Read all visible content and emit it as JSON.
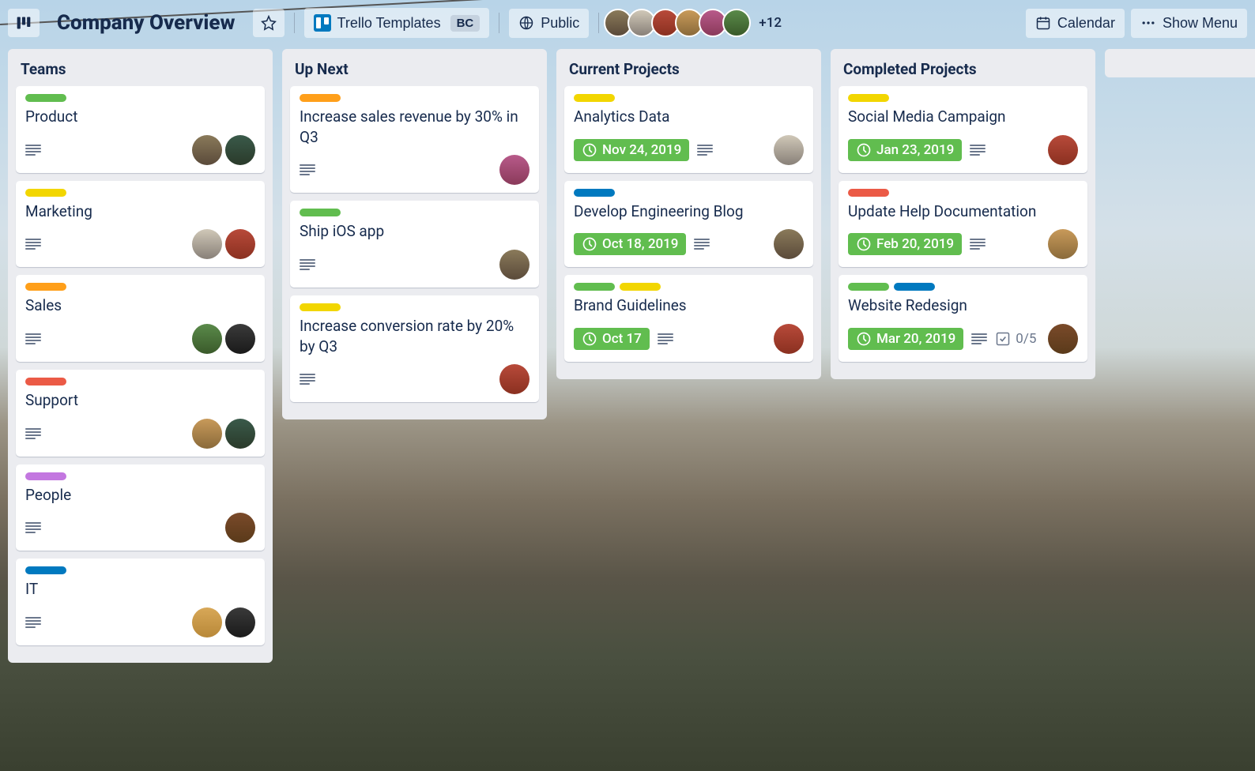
{
  "header": {
    "board_title": "Company Overview",
    "team_name": "Trello Templates",
    "team_badge": "BC",
    "visibility": "Public",
    "more_members": "+12",
    "calendar_label": "Calendar",
    "show_menu_label": "Show Menu"
  },
  "lists": [
    {
      "title": "Teams",
      "cards": [
        {
          "labels": [
            "green"
          ],
          "title": "Product",
          "has_desc": true,
          "avatars": [
            "av1",
            "av2"
          ]
        },
        {
          "labels": [
            "yellow"
          ],
          "title": "Marketing",
          "has_desc": true,
          "avatars": [
            "av3",
            "av4"
          ]
        },
        {
          "labels": [
            "orange"
          ],
          "title": "Sales",
          "has_desc": true,
          "avatars": [
            "av5",
            "av6"
          ]
        },
        {
          "labels": [
            "red"
          ],
          "title": "Support",
          "has_desc": true,
          "avatars": [
            "av7",
            "av2"
          ]
        },
        {
          "labels": [
            "purple"
          ],
          "title": "People",
          "has_desc": true,
          "avatars": [
            "av11"
          ]
        },
        {
          "labels": [
            "blue"
          ],
          "title": "IT",
          "has_desc": true,
          "avatars": [
            "av10",
            "av6"
          ]
        }
      ]
    },
    {
      "title": "Up Next",
      "cards": [
        {
          "labels": [
            "orange"
          ],
          "title": "Increase sales revenue by 30% in Q3",
          "has_desc": true,
          "avatars": [
            "av8"
          ]
        },
        {
          "labels": [
            "green"
          ],
          "title": "Ship iOS app",
          "has_desc": true,
          "avatars": [
            "av1"
          ]
        },
        {
          "labels": [
            "yellow"
          ],
          "title": "Increase conversion rate by 20% by Q3",
          "has_desc": true,
          "avatars": [
            "av4"
          ]
        }
      ]
    },
    {
      "title": "Current Projects",
      "cards": [
        {
          "labels": [
            "yellow"
          ],
          "title": "Analytics Data",
          "has_desc": true,
          "due": "Nov 24, 2019",
          "avatars": [
            "av3"
          ]
        },
        {
          "labels": [
            "blue"
          ],
          "title": "Develop Engineering Blog",
          "has_desc": true,
          "due": "Oct 18, 2019",
          "avatars": [
            "av1"
          ]
        },
        {
          "labels": [
            "green",
            "yellow"
          ],
          "title": "Brand Guidelines",
          "has_desc": true,
          "due": "Oct 17",
          "avatars": [
            "av4"
          ]
        }
      ]
    },
    {
      "title": "Completed Projects",
      "cards": [
        {
          "labels": [
            "yellow"
          ],
          "title": "Social Media Campaign",
          "has_desc": true,
          "due": "Jan 23, 2019",
          "avatars": [
            "av4"
          ]
        },
        {
          "labels": [
            "red"
          ],
          "title": "Update Help Documentation",
          "has_desc": true,
          "due": "Feb 20, 2019",
          "avatars": [
            "av7"
          ]
        },
        {
          "labels": [
            "green",
            "blue"
          ],
          "title": "Website Redesign",
          "has_desc": true,
          "due": "Mar 20, 2019",
          "checklist": "0/5",
          "avatars": [
            "av11"
          ]
        }
      ]
    },
    {
      "title": "",
      "cards": []
    }
  ]
}
